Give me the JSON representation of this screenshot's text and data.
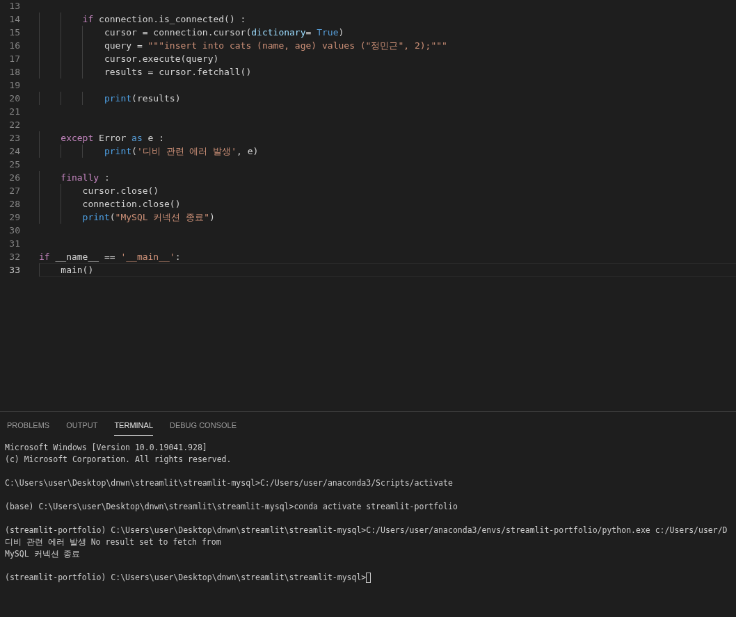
{
  "editor": {
    "lines": [
      {
        "number": "13"
      },
      {
        "number": "14",
        "tokens": [
          {
            "kind": "keyword",
            "text": "        if"
          },
          {
            "kind": "plain",
            "text": " connection.is_connected() :"
          }
        ]
      },
      {
        "number": "15",
        "tokens": [
          {
            "kind": "plain",
            "text": "            cursor = connection.cursor("
          },
          {
            "kind": "param",
            "text": "dictionary"
          },
          {
            "kind": "plain",
            "text": "= "
          },
          {
            "kind": "constant",
            "text": "True"
          },
          {
            "kind": "plain",
            "text": ")"
          }
        ]
      },
      {
        "number": "16",
        "tokens": [
          {
            "kind": "plain",
            "text": "            query = "
          },
          {
            "kind": "string",
            "text": "\"\"\"insert into cats (name, age) values (\"정민근\", 2);\"\"\""
          }
        ]
      },
      {
        "number": "17",
        "tokens": [
          {
            "kind": "plain",
            "text": "            cursor.execute(query)"
          }
        ]
      },
      {
        "number": "18",
        "tokens": [
          {
            "kind": "plain",
            "text": "            results = cursor.fetchall()"
          }
        ]
      },
      {
        "number": "19"
      },
      {
        "number": "20",
        "tokens": [
          {
            "kind": "builtin",
            "text": "            print"
          },
          {
            "kind": "plain",
            "text": "(results)"
          }
        ]
      },
      {
        "number": "21"
      },
      {
        "number": "22"
      },
      {
        "number": "23",
        "tokens": [
          {
            "kind": "keyword",
            "text": "    except"
          },
          {
            "kind": "plain",
            "text": " Error "
          },
          {
            "kind": "constant",
            "text": "as"
          },
          {
            "kind": "plain",
            "text": " e :"
          }
        ]
      },
      {
        "number": "24",
        "tokens": [
          {
            "kind": "builtin",
            "text": "            print"
          },
          {
            "kind": "plain",
            "text": "("
          },
          {
            "kind": "string",
            "text": "'디비 관련 에러 발생'"
          },
          {
            "kind": "plain",
            "text": ", e)"
          }
        ]
      },
      {
        "number": "25"
      },
      {
        "number": "26",
        "tokens": [
          {
            "kind": "keyword",
            "text": "    finally"
          },
          {
            "kind": "plain",
            "text": " :"
          }
        ]
      },
      {
        "number": "27",
        "tokens": [
          {
            "kind": "plain",
            "text": "        cursor.close()"
          }
        ]
      },
      {
        "number": "28",
        "tokens": [
          {
            "kind": "plain",
            "text": "        connection.close()"
          }
        ]
      },
      {
        "number": "29",
        "tokens": [
          {
            "kind": "builtin",
            "text": "        print"
          },
          {
            "kind": "plain",
            "text": "("
          },
          {
            "kind": "string",
            "text": "\"MySQL 커넥션 종료\""
          },
          {
            "kind": "plain",
            "text": ")"
          }
        ]
      },
      {
        "number": "30"
      },
      {
        "number": "31"
      },
      {
        "number": "32",
        "tokens": [
          {
            "kind": "keyword",
            "text": "if"
          },
          {
            "kind": "plain",
            "text": " __name__ == "
          },
          {
            "kind": "string",
            "text": "'__main__'"
          },
          {
            "kind": "plain",
            "text": ":"
          }
        ]
      },
      {
        "number": "33",
        "active": true,
        "tokens": [
          {
            "kind": "plain",
            "text": "    main()"
          }
        ]
      }
    ]
  },
  "panel": {
    "tabs": [
      {
        "label": "PROBLEMS",
        "selected": false
      },
      {
        "label": "OUTPUT",
        "selected": false
      },
      {
        "label": "TERMINAL",
        "selected": true
      },
      {
        "label": "DEBUG CONSOLE",
        "selected": false
      }
    ],
    "terminal_blocks": [
      {
        "lines": [
          {
            "text": "Microsoft Windows [Version 10.0.19041.928]"
          },
          {
            "text": "(c) Microsoft Corporation. All rights reserved."
          }
        ]
      },
      {
        "lines": [
          {
            "text": "C:\\Users\\user\\Desktop\\dnwn\\streamlit\\streamlit-mysql>C:/Users/user/anaconda3/Scripts/activate"
          }
        ]
      },
      {
        "lines": [
          {
            "text": "(base) C:\\Users\\user\\Desktop\\dnwn\\streamlit\\streamlit-mysql>conda activate streamlit-portfolio"
          }
        ]
      },
      {
        "lines": [
          {
            "text": "(streamlit-portfolio) C:\\Users\\user\\Desktop\\dnwn\\streamlit\\streamlit-mysql>C:/Users/user/anaconda3/envs/streamlit-portfolio/python.exe c:/Users/user/D"
          },
          {
            "text": "디비 관련 에러 발생 No result set to fetch from"
          },
          {
            "text": "MySQL 커넥션 종료"
          }
        ]
      },
      {
        "lines": [
          {
            "text": "(streamlit-portfolio) C:\\Users\\user\\Desktop\\dnwn\\streamlit\\streamlit-mysql>",
            "cursor": true
          }
        ]
      }
    ]
  }
}
